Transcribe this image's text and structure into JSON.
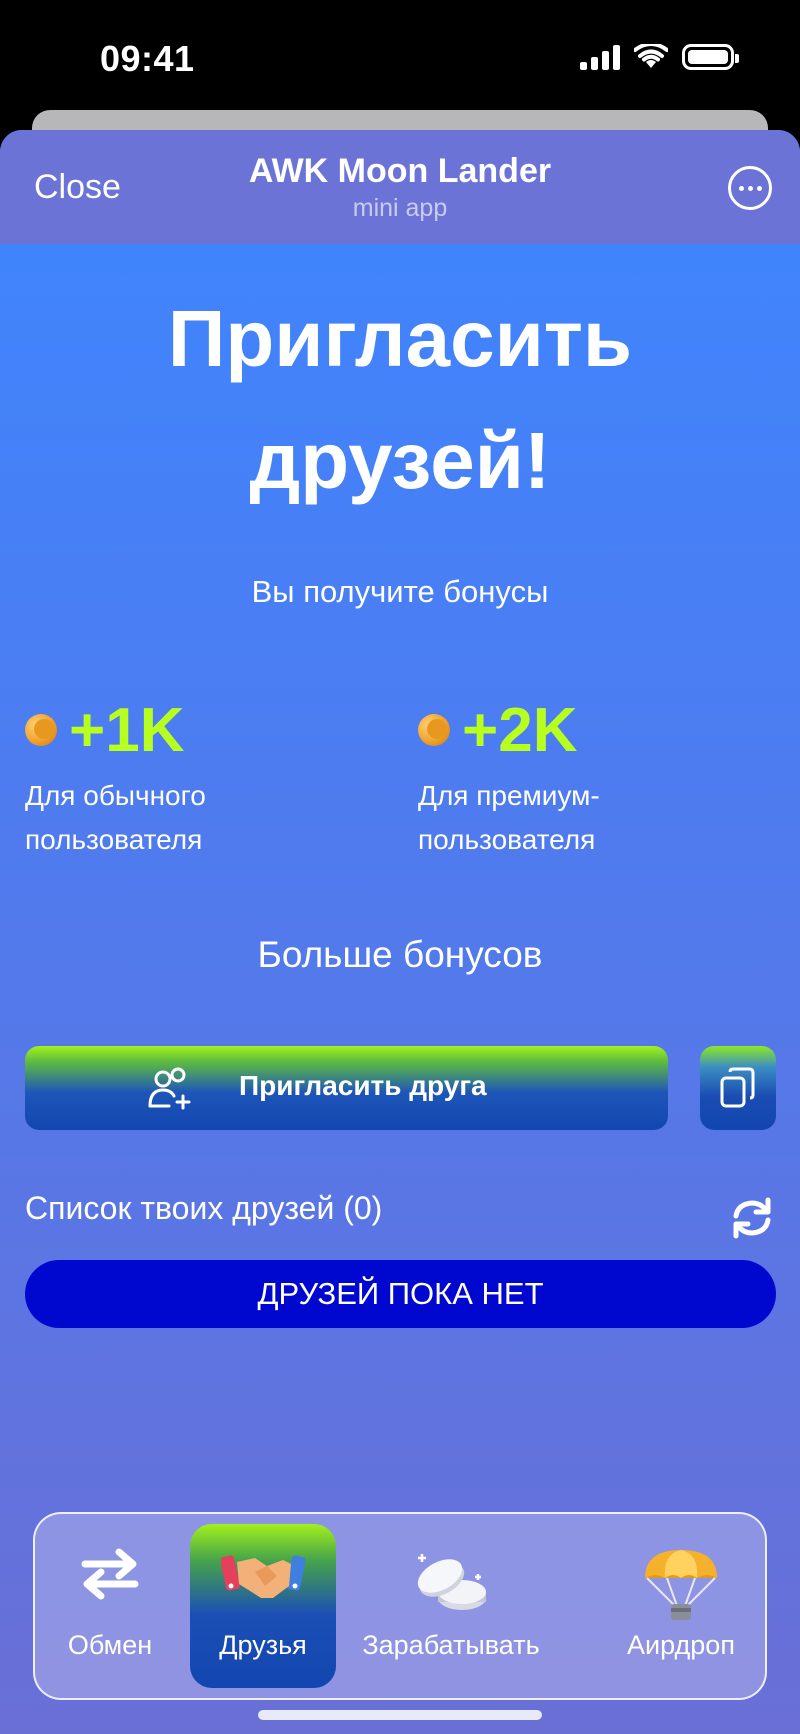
{
  "status_bar": {
    "time": "09:41"
  },
  "topbar": {
    "close_label": "Close",
    "title": "AWK Moon Lander",
    "subtitle": "mini app",
    "more_icon": "ellipsis-circle-icon"
  },
  "hero": {
    "title": "Пригласить друзей!",
    "subtitle": "Вы получите бонусы"
  },
  "bonuses": [
    {
      "amount": "+1K",
      "description": "Для обычного пользователя",
      "icon": "moon-coin-icon"
    },
    {
      "amount": "+2K",
      "description": "Для премиум-пользователя",
      "icon": "moon-coin-icon"
    }
  ],
  "more_bonuses_label": "Больше бонусов",
  "invite": {
    "label": "Пригласить друга",
    "icon": "add-user-icon",
    "copy_icon": "copy-icon"
  },
  "friends": {
    "heading": "Список твоих друзей (0)",
    "empty_label": "ДРУЗЕЙ ПОКА НЕТ",
    "refresh_icon": "refresh-icon"
  },
  "nav": {
    "items": [
      {
        "label": "Обмен",
        "icon": "swap-arrows-icon",
        "active": false
      },
      {
        "label": "Друзья",
        "icon": "handshake-icon",
        "active": true
      },
      {
        "label": "Зарабатывать",
        "icon": "coins-icon",
        "active": false
      },
      {
        "label": "Аирдроп",
        "icon": "parachute-icon",
        "active": false
      }
    ]
  },
  "colors": {
    "accent_green": "#b6ff1f",
    "button_blue": "#1246b0",
    "empty_banner": "#0008cf",
    "topbar": "#6c73d6"
  }
}
